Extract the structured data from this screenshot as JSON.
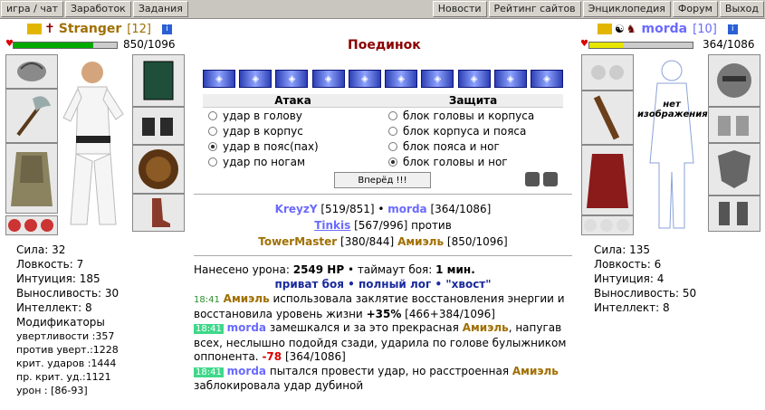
{
  "topbar": {
    "left_items": [
      "игра / чат",
      "Заработок",
      "Задания"
    ],
    "right_items": [
      "Новости",
      "Рейтинг сайтов",
      "Энциклопедия",
      "Форум",
      "Выход"
    ]
  },
  "left_player": {
    "name": "Stranger",
    "level": "[12]",
    "hp": "850/1096",
    "hp_fraction": 0.7755,
    "no_image": "",
    "stats": [
      {
        "label": "Сила:",
        "value": "32"
      },
      {
        "label": "Ловкость:",
        "value": "7"
      },
      {
        "label": "Интуиция:",
        "value": "185"
      },
      {
        "label": "Выносливость:",
        "value": "30"
      },
      {
        "label": "Интеллект:",
        "value": "8"
      }
    ],
    "modifiers_title": "Модификаторы",
    "modifiers": [
      {
        "label": "увертливости :",
        "value": "357"
      },
      {
        "label": "против уверт.:",
        "value": "1228"
      },
      {
        "label": "крит. ударов :",
        "value": "1444"
      },
      {
        "label": "пр. крит. уд.:",
        "value": "1121"
      },
      {
        "label": "урон :",
        "value": "[86-93]"
      }
    ]
  },
  "right_player": {
    "name": "morda",
    "level": "[10]",
    "hp": "364/1086",
    "hp_fraction": 0.3352,
    "no_image": "нет изображения",
    "stats": [
      {
        "label": "Сила:",
        "value": "135"
      },
      {
        "label": "Ловкость:",
        "value": "6"
      },
      {
        "label": "Интуиция:",
        "value": "4"
      },
      {
        "label": "Выносливость:",
        "value": "50"
      },
      {
        "label": "Интеллект:",
        "value": "8"
      }
    ]
  },
  "duel": {
    "title": "Поединок",
    "gems_filled": 10,
    "gems_total": 10,
    "attack_header": "Атака",
    "defense_header": "Защита",
    "attacks": [
      "удар в голову",
      "удар в корпус",
      "удар в пояс(пах)",
      "удар по ногам"
    ],
    "attack_selected": 2,
    "defenses": [
      "блок головы и корпуса",
      "блок корпуса и пояса",
      "блок пояса и ног",
      "блок головы и ног"
    ],
    "defense_selected": 3,
    "forward_button": "Вперёд !!!"
  },
  "fight_info": {
    "line1": [
      {
        "name": "KreyzY",
        "hp": "[519/851]"
      },
      {
        "name": "morda",
        "hp": "[364/1086]"
      }
    ],
    "line2_name": "Tinkis",
    "line2_hp": "[567/996]",
    "vs": "против",
    "line3": [
      {
        "name": "TowerMaster",
        "hp": "[380/844]"
      },
      {
        "name": "Амиэль",
        "hp": "[850/1096]"
      }
    ]
  },
  "damage": {
    "label": "Нанесено урона:",
    "value": "2549 HP",
    "timeout_label": "таймаут боя:",
    "timeout_value": "1 мин.",
    "links": [
      "приват боя",
      "полный лог",
      "\"хвост\""
    ]
  },
  "log": [
    {
      "time": "18:41",
      "actor": "Амиэль",
      "text": "использовала заклятие восстановления энергии и восстановила уровень жизни",
      "amount": "+35%",
      "tail": "[466+384/1096]"
    },
    {
      "time": "18:41",
      "actor": "morda",
      "text": "замешкался и за это прекрасная",
      "actor2": "Амиэль",
      "text2": ", напугав всех, неслышно подойдя сзади, ударила по голове булыжником оппонента.",
      "amount": "-78",
      "tail": "[364/1086]"
    },
    {
      "time": "18:41",
      "actor": "morda",
      "text": "пытался провести удар, но расстроенная",
      "actor2": "Амиэль",
      "text2": "заблокировала удар дубиной"
    }
  ]
}
